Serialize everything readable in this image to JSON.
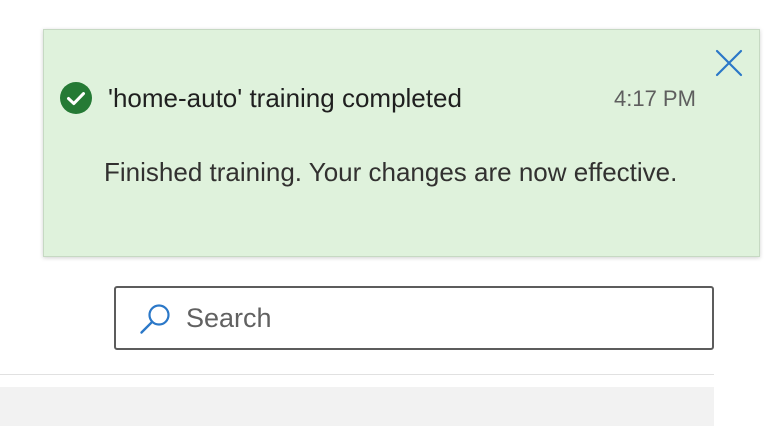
{
  "notification": {
    "status": "success",
    "title": "'home-auto' training completed",
    "time": "4:17 PM",
    "message": "Finished training. Your changes are now effective.",
    "icons": {
      "status": "check-circle-icon",
      "close": "close-icon"
    }
  },
  "search": {
    "placeholder": "Search",
    "value": "",
    "icon": "search-icon"
  },
  "colors": {
    "success_background": "#dff2dc",
    "success_icon": "#257a35",
    "accent": "#2b78c8"
  }
}
